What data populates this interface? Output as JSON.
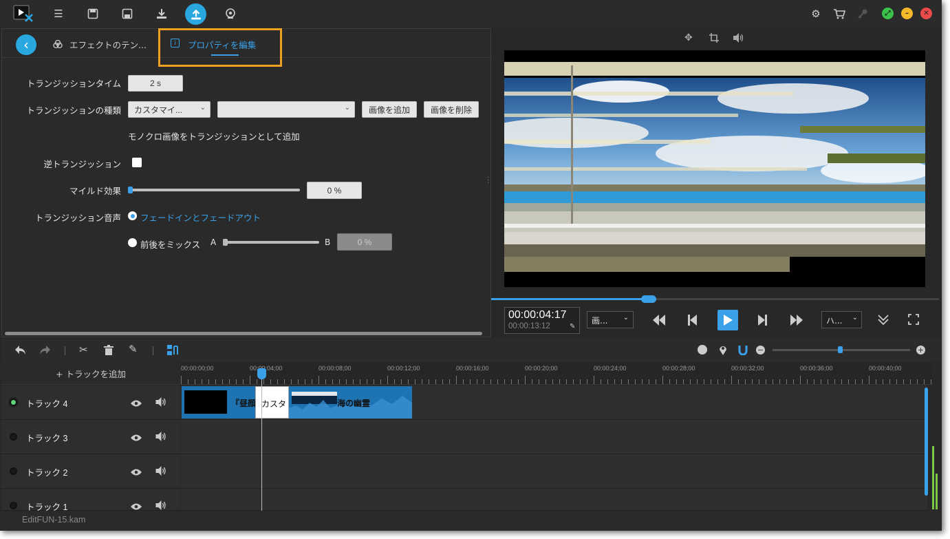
{
  "topbar": {
    "icons": [
      "logo-icon",
      "list-icon",
      "save-icon",
      "save-as-icon",
      "download-icon",
      "export-icon",
      "webcam-icon",
      "gear-icon",
      "cart-icon",
      "key-icon",
      "maximize-icon",
      "minimize-icon",
      "close-icon"
    ]
  },
  "tabs": {
    "back": "‹",
    "effects": "エフェクトのテン...",
    "properties": "プロパティを編集"
  },
  "props": {
    "transition_time_label": "トランジッションタイム",
    "transition_time_value": "2 s",
    "transition_type_label": "トランジッションの種類",
    "type_select": "カスタマイ...",
    "image_select": "",
    "add_image": "画像を追加",
    "delete_image": "画像を削除",
    "mono_note": "モノクロ画像をトランジッションとして追加",
    "reverse_label": "逆トランジッション",
    "mild_label": "マイルド効果",
    "mild_value": "0 %",
    "mild_level": 0,
    "sound_label": "トランジッション音声",
    "fade_option": "フェードインとフェードアウト",
    "mix_option": "前後をミックス",
    "mix_a": "A",
    "mix_b": "B",
    "mix_value": "0 %",
    "mix_level": 0
  },
  "preview": {
    "time_current": "00:00:04:17",
    "time_total": "00:00:13:12",
    "quality_select": "画...",
    "speed_select": "ハ...",
    "progress": 0.35
  },
  "timeline": {
    "add_track": "+ トラックを追加",
    "ticks": [
      "00:00:00;00",
      "00:00:04;00",
      "00:00:08;00",
      "00:00:12;00",
      "00:00:16;00",
      "00:00:20;00",
      "00:00:24;00",
      "00:00:28;00",
      "00:00:32;00",
      "00:00:36;00",
      "00:00:40;00"
    ],
    "tracks": [
      {
        "name": "トラック 4",
        "active": true
      },
      {
        "name": "トラック 3",
        "active": false
      },
      {
        "name": "トラック 2",
        "active": false
      },
      {
        "name": "トラック 1",
        "active": false
      }
    ],
    "clips": {
      "clip1": "『昼顔",
      "transition": "カスタ",
      "clip2": "海の幽霊"
    }
  },
  "status": {
    "filename": "EditFUN-15.kam"
  },
  "colors": {
    "accent": "#3aa0e8",
    "highlight_box": "#f0a020",
    "bg": "#282828"
  }
}
